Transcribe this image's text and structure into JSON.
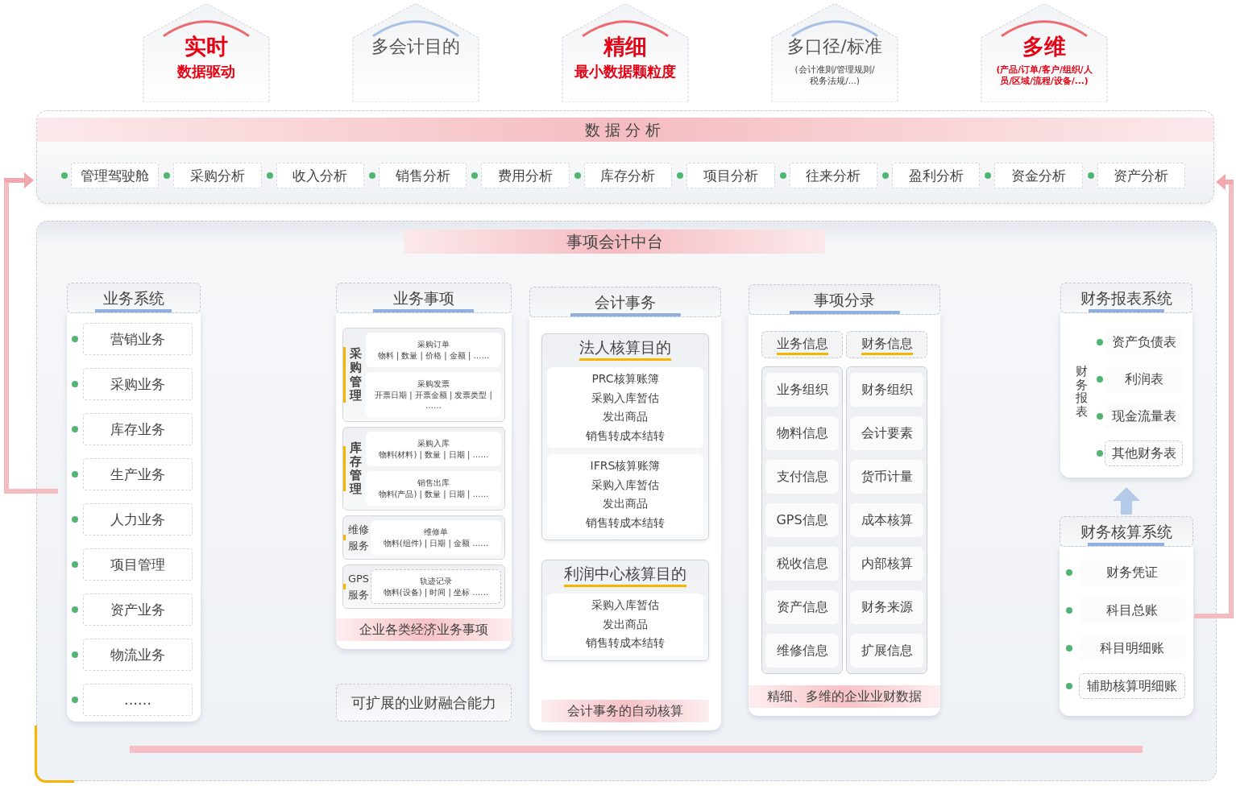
{
  "badges": [
    {
      "kind": "emphasis",
      "title": "实时",
      "subtitle": "数据驱动"
    },
    {
      "kind": "plain",
      "title": "多会计目的"
    },
    {
      "kind": "emphasis",
      "title": "精细",
      "subtitle": "最小数据颗粒度"
    },
    {
      "kind": "plain",
      "title": "多口径/标准",
      "subtitle": "(会计准则/管理规则/税务法规/...)"
    },
    {
      "kind": "emphasis",
      "title": "多维",
      "subtitle": "(产品/订单/客户/组织/人员/区域/流程/设备/...)"
    }
  ],
  "data_analysis": {
    "title": "数据分析",
    "items": [
      "管理驾驶舱",
      "采购分析",
      "收入分析",
      "销售分析",
      "费用分析",
      "库存分析",
      "项目分析",
      "往来分析",
      "盈利分析",
      "资金分析",
      "资产分析"
    ]
  },
  "platform": {
    "title": "事项会计中台",
    "business_systems": {
      "title": "业务系统",
      "items": [
        "营销业务",
        "采购业务",
        "库存业务",
        "生产业务",
        "人力业务",
        "项目管理",
        "资产业务",
        "物流业务",
        "……"
      ]
    },
    "business_matters": {
      "title": "业务事项",
      "groups": [
        {
          "label": "采购管理",
          "kind": "vertical",
          "entries": [
            {
              "name": "采购订单",
              "fields": "物料 | 数量 | 价格 | 金额 | ……",
              "extensible": false
            },
            {
              "name": "采购发票",
              "fields": "开票日期 | 开票金额 | 发票类型 | ……",
              "extensible": false
            }
          ]
        },
        {
          "label": "库存管理",
          "kind": "vertical",
          "entries": [
            {
              "name": "采购入库",
              "fields": "物料(材料) | 数量 | 日期 | ……",
              "extensible": false
            },
            {
              "name": "销售出库",
              "fields": "物料(产品) | 数量 | 日期 | ……",
              "extensible": false
            }
          ]
        },
        {
          "label": "维修服务",
          "kind": "stacked",
          "entries": [
            {
              "name": "维修单",
              "fields": "物料(组件) | 日期 | 金额 ……",
              "extensible": false
            }
          ]
        },
        {
          "label": "GPS服务",
          "kind": "stacked",
          "entries": [
            {
              "name": "轨迹记录",
              "fields": "物料(设备) | 时间 | 坐标 ……",
              "extensible": true
            }
          ]
        }
      ],
      "footer": "企业各类经济业务事项"
    },
    "extension": "可扩展的业财融合能力",
    "accounting": {
      "title": "会计事务",
      "purposes": [
        {
          "title": "法人核算目的",
          "books": [
            [
              "PRC核算账簿",
              "采购入库暂估",
              "发出商品",
              "销售转成本结转"
            ],
            [
              "IFRS核算账簿",
              "采购入库暂估",
              "发出商品",
              "销售转成本结转"
            ]
          ]
        },
        {
          "title": "利润中心核算目的",
          "books": [
            [
              "采购入库暂估",
              "发出商品",
              "销售转成本结转"
            ]
          ]
        }
      ],
      "footer": "会计事务的自动核算"
    },
    "entries": {
      "title": "事项分录",
      "columns": [
        {
          "heading": "业务信息",
          "items": [
            "业务组织",
            "物料信息",
            "支付信息",
            "GPS信息",
            "税收信息",
            "资产信息",
            "维修信息"
          ]
        },
        {
          "heading": "财务信息",
          "items": [
            "财务组织",
            "会计要素",
            "货币计量",
            "成本核算",
            "内部核算",
            "财务来源",
            "扩展信息"
          ]
        }
      ],
      "footer": "精细、多维的企业业财数据"
    },
    "report_system": {
      "title": "财务报表系统",
      "label": "财务报表",
      "items": [
        {
          "name": "资产负债表",
          "extensible": false
        },
        {
          "name": "利润表",
          "extensible": false
        },
        {
          "name": "现金流量表",
          "extensible": false
        },
        {
          "name": "其他财务表",
          "extensible": true
        }
      ]
    },
    "ledger_system": {
      "title": "财务核算系统",
      "items": [
        {
          "name": "财务凭证",
          "extensible": false
        },
        {
          "name": "科目总账",
          "extensible": false
        },
        {
          "name": "科目明细账",
          "extensible": false
        },
        {
          "name": "辅助核算明细账",
          "extensible": true
        }
      ]
    }
  }
}
